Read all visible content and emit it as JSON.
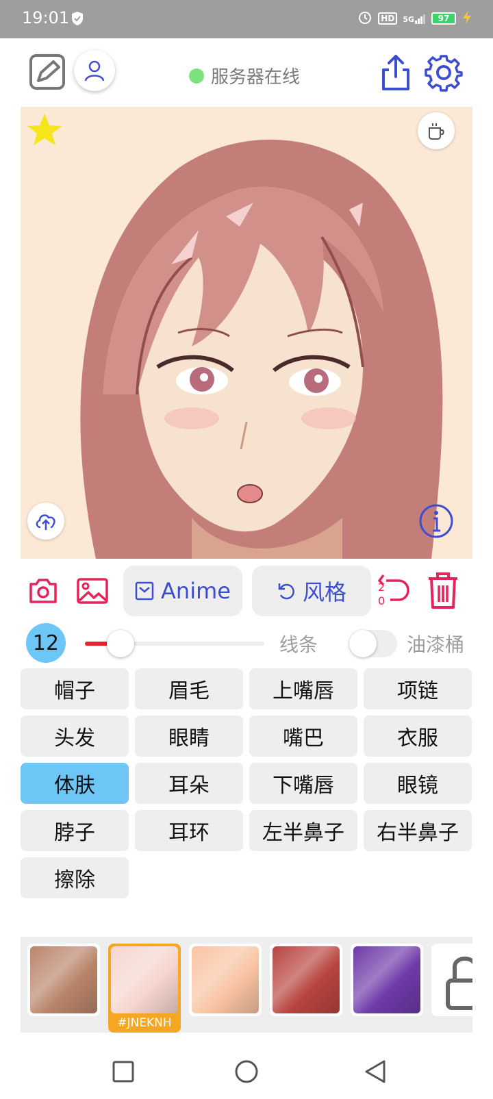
{
  "status_bar": {
    "time": "19:01",
    "battery": "97",
    "network": "5G"
  },
  "header": {
    "server_status": "服务器在线"
  },
  "toolbar": {
    "anime_label": "Anime",
    "style_label": "风格",
    "undo_counter_top": "2",
    "undo_counter_bottom": "0"
  },
  "brush": {
    "size": "12",
    "size_fraction": 0.2,
    "line_label": "线条",
    "bucket_label": "油漆桶",
    "bucket_enabled": false
  },
  "parts": [
    {
      "label": "帽子"
    },
    {
      "label": "眉毛"
    },
    {
      "label": "上嘴唇"
    },
    {
      "label": "项链"
    },
    {
      "label": "头发"
    },
    {
      "label": "眼睛"
    },
    {
      "label": "嘴巴"
    },
    {
      "label": "衣服"
    },
    {
      "label": "体肤",
      "active": true
    },
    {
      "label": "耳朵"
    },
    {
      "label": "下嘴唇"
    },
    {
      "label": "眼镜"
    },
    {
      "label": "脖子"
    },
    {
      "label": "耳环"
    },
    {
      "label": "左半鼻子"
    },
    {
      "label": "右半鼻子"
    },
    {
      "label": "擦除"
    }
  ],
  "textures": {
    "selected_code": "#JNEKNH",
    "items": [
      {
        "name": "brown-striped-texture",
        "color": "#b9856a"
      },
      {
        "name": "pale-pink-texture",
        "color": "#f6d6cf"
      },
      {
        "name": "peach-texture",
        "color": "#f9c3a2"
      },
      {
        "name": "red-dark-texture",
        "color": "#b8443f"
      },
      {
        "name": "purple-texture",
        "color": "#6e3aa8"
      },
      {
        "name": "lock-texture",
        "color": "#ffffff"
      }
    ]
  },
  "colors": {
    "accent_blue": "#3d4dd0",
    "accent_red": "#e3245a",
    "highlight": "#6ec6f7",
    "online": "#7ee07e"
  }
}
